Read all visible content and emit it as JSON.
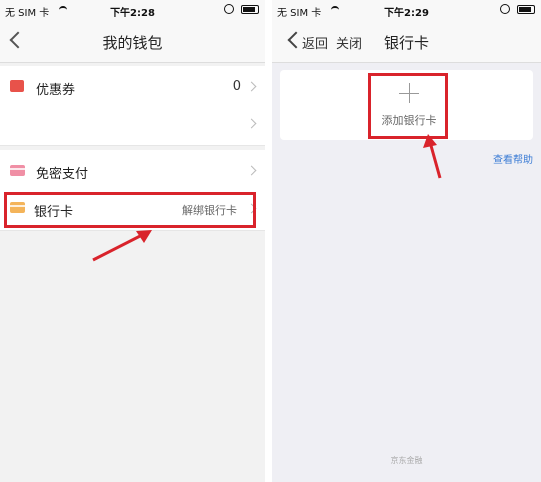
{
  "left": {
    "status": {
      "carrier": "无 SIM 卡",
      "time": "下午2:28"
    },
    "nav_title": "我的钱包",
    "rows": [
      {
        "label": "优惠券",
        "value": "0"
      },
      {
        "label": ""
      },
      {
        "label": "免密支付"
      },
      {
        "label": "银行卡",
        "sub": "解绑银行卡"
      }
    ]
  },
  "right": {
    "status": {
      "carrier": "无 SIM 卡",
      "time": "下午2:29"
    },
    "back_label": "返回",
    "close_label": "关闭",
    "nav_title": "银行卡",
    "add_card_label": "添加银行卡",
    "help_link": "查看帮助",
    "footer": "京东金融"
  },
  "colors": {
    "highlight": "#d9232b",
    "link": "#3a7bd5"
  }
}
